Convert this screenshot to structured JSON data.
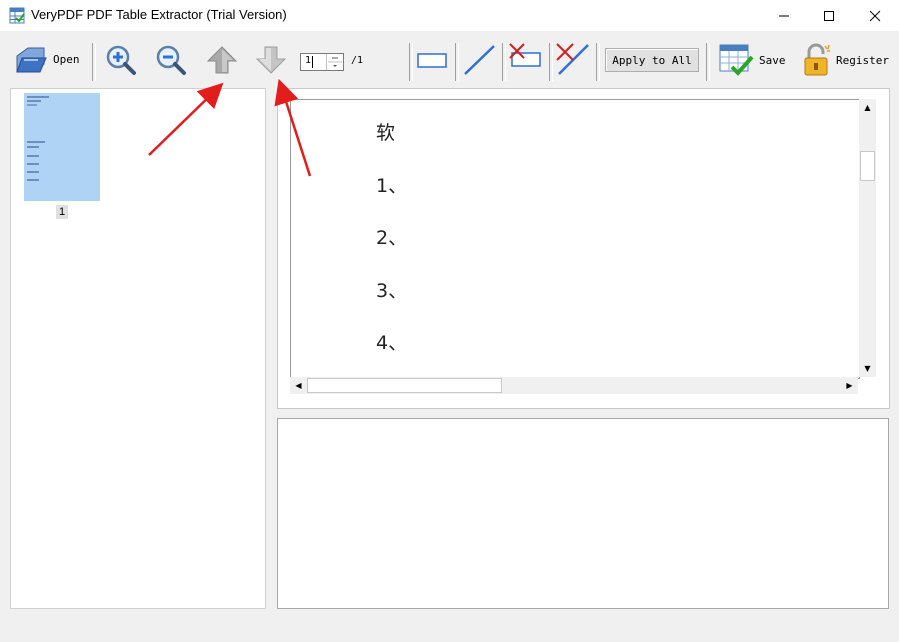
{
  "window": {
    "title": "VeryPDF PDF Table Extractor (Trial Version)",
    "minimize_icon": "minimize-icon",
    "maximize_icon": "maximize-icon",
    "close_icon": "close-icon"
  },
  "toolbar": {
    "open_label": "Open",
    "page_value": "1",
    "page_total": "/1",
    "apply_label": "Apply to All",
    "save_label": "Save",
    "register_label": "Register"
  },
  "thumbnails": [
    {
      "label": "1"
    }
  ],
  "document": {
    "lines": [
      "软",
      "1、",
      "2、",
      "3、",
      "4、"
    ]
  },
  "colors": {
    "annotation_arrow": "#e31c1c",
    "thumbnail_bg": "#aed3f5",
    "tool_blue": "#2f6fd6",
    "tool_red": "#d02020"
  },
  "icons": [
    "open-folder-icon",
    "zoom-in-icon",
    "zoom-out-icon",
    "previous-page-icon",
    "next-page-icon",
    "draw-rectangle-icon",
    "draw-line-icon",
    "delete-rectangle-icon",
    "delete-line-icon",
    "save-table-icon",
    "register-lock-icon"
  ]
}
